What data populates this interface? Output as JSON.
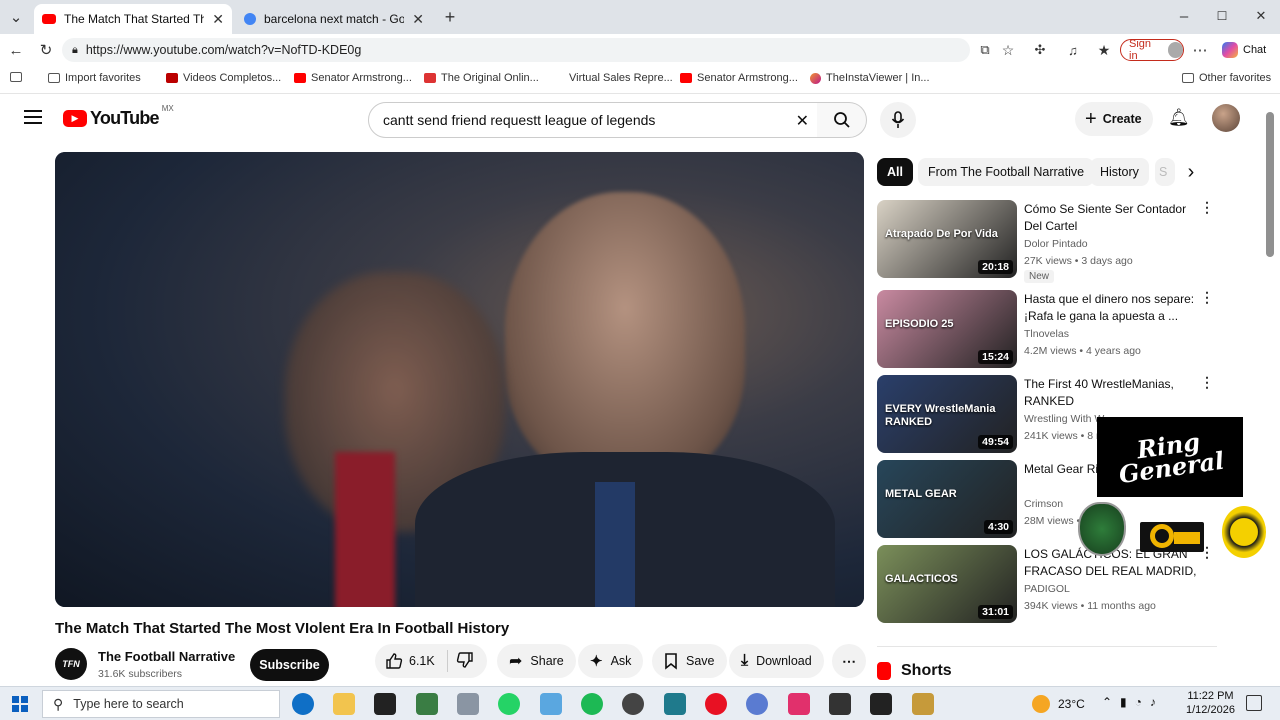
{
  "browser": {
    "tabs": [
      {
        "title": "The Match That Started The Most",
        "active": true
      },
      {
        "title": "barcelona next match - Google Se",
        "active": false
      }
    ],
    "url": "https://www.youtube.com/watch?v=NofTD-KDE0g",
    "sign_in": "Sign in",
    "chat": "Chat",
    "bookmarks": [
      "Import favorites",
      "Videos Completos...",
      "Senator Armstrong...",
      "The Original Onlin...",
      "Virtual Sales Repre...",
      "Senator Armstrong...",
      "TheInstaViewer | In..."
    ],
    "other_favorites": "Other favorites"
  },
  "youtube": {
    "logo": "YouTube",
    "region": "MX",
    "search_query": "cantt send friend requestt league of legends",
    "create_label": "Create",
    "filters": [
      "All",
      "From The Football Narrative",
      "History",
      "S"
    ],
    "video": {
      "title": "The Match That Started The Most VIolent Era In Football History",
      "channel": "The Football Narrative",
      "channel_initials": "TFN",
      "subscribers": "31.6K subscribers",
      "subscribe_label": "Subscribe",
      "likes": "6.1K",
      "share_label": "Share",
      "ask_label": "Ask",
      "save_label": "Save",
      "download_label": "Download"
    },
    "recommendations": [
      {
        "title": "Cómo Se Siente Ser Contador Del Cartel",
        "channel": "Dolor Pintado",
        "meta": "27K views • 3 days ago",
        "duration": "20:18",
        "badge": "New",
        "thumb_text": "Atrapado De Por Vida",
        "thumb_color": "#d9d2c5"
      },
      {
        "title": "Hasta que el dinero nos separe: ¡Rafa le gana la apuesta a ...",
        "channel": "Tlnovelas",
        "meta": "4.2M views • 4 years ago",
        "duration": "15:24",
        "badge": "",
        "thumb_text": "EPISODIO 25",
        "thumb_color": "#c98aa1"
      },
      {
        "title": "The First 40 WrestleManias, RANKED",
        "channel": "Wrestling With W...",
        "meta": "241K views • 8 m...",
        "duration": "49:54",
        "badge": "",
        "thumb_text": "EVERY WrestleMania RANKED",
        "thumb_color": "#2a3f6b"
      },
      {
        "title": "Metal Gear Rising: Revengeance",
        "channel": "Crimson",
        "meta": "28M views • ...ago",
        "duration": "4:30",
        "badge": "",
        "thumb_text": "METAL GEAR",
        "thumb_color": "#27465a"
      },
      {
        "title": "LOS GALÁCTICOS: EL GRAN FRACASO DEL REAL MADRID, ...",
        "channel": "PADIGOL",
        "meta": "394K views • 11 months ago",
        "duration": "31:01",
        "badge": "",
        "thumb_text": "GALACTICOS",
        "thumb_color": "#7b8f5a"
      }
    ],
    "shorts_label": "Shorts",
    "overlay_logo": "Ring General"
  },
  "taskbar": {
    "search_placeholder": "Type here to search",
    "temperature": "23°C",
    "time": "11:22 PM",
    "date": "1/12/2026"
  }
}
